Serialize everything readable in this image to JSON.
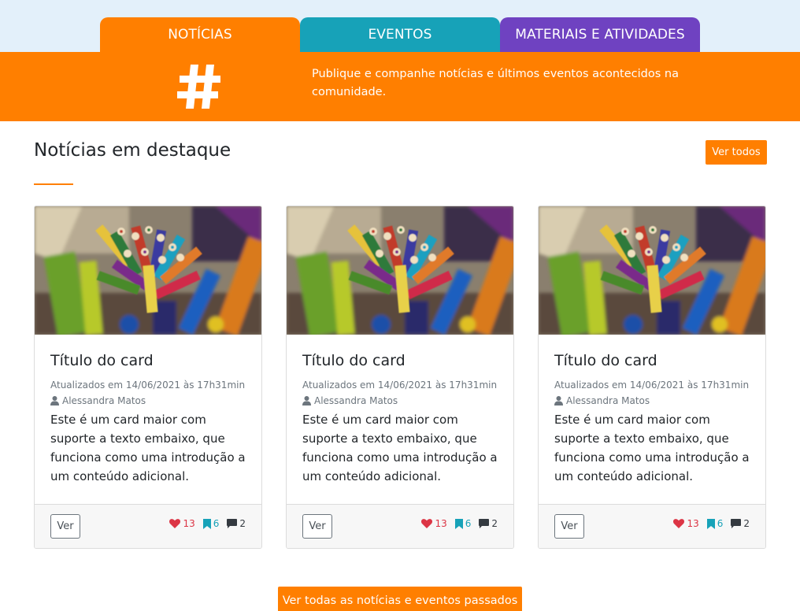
{
  "tabs": [
    {
      "label": "NOTÍCIAS",
      "color": "#ff7f00",
      "active": true
    },
    {
      "label": "EVENTOS",
      "color": "#17a2b8",
      "active": false
    },
    {
      "label": "MATERIAIS E ATIVIDADES",
      "color": "#6f42c1",
      "active": false
    }
  ],
  "banner": {
    "icon": "hashtag-icon",
    "text": "Publique e companhe notícias e últimos eventos acontecidos na comunidade.",
    "color": "#ff7f00"
  },
  "section": {
    "title": "Notícias em destaque",
    "see_all_label": "Ver todos"
  },
  "cards": [
    {
      "image": "colored-pencils-photo",
      "title": "Título do card",
      "updated": "Atualizados em 14/06/2021 às 17h31min",
      "author": "Alessandra Matos",
      "text": "Este é um card maior com suporte a texto embaixo, que funciona como uma introdução a um conteúdo adicional.",
      "button_label": "Ver",
      "likes": "13",
      "saves": "6",
      "comments": "2"
    },
    {
      "image": "colored-pencils-photo",
      "title": "Título do card",
      "updated": "Atualizados em 14/06/2021 às 17h31min",
      "author": "Alessandra Matos",
      "text": "Este é um card maior com suporte a texto embaixo, que funciona como uma introdução a um conteúdo adicional.",
      "button_label": "Ver",
      "likes": "13",
      "saves": "6",
      "comments": "2"
    },
    {
      "image": "colored-pencils-photo",
      "title": "Título do card",
      "updated": "Atualizados em 14/06/2021 às 17h31min",
      "author": "Alessandra Matos",
      "text": "Este é um card maior com suporte a texto embaixo, que funciona como uma introdução a um conteúdo adicional.",
      "button_label": "Ver",
      "likes": "13",
      "saves": "6",
      "comments": "2"
    }
  ],
  "footer_button_label": "Ver todas as notícias e eventos passados",
  "colors": {
    "accent": "#ff7f00",
    "likes": "#dc3545",
    "saves": "#17a2b8",
    "comments": "#343a40"
  }
}
